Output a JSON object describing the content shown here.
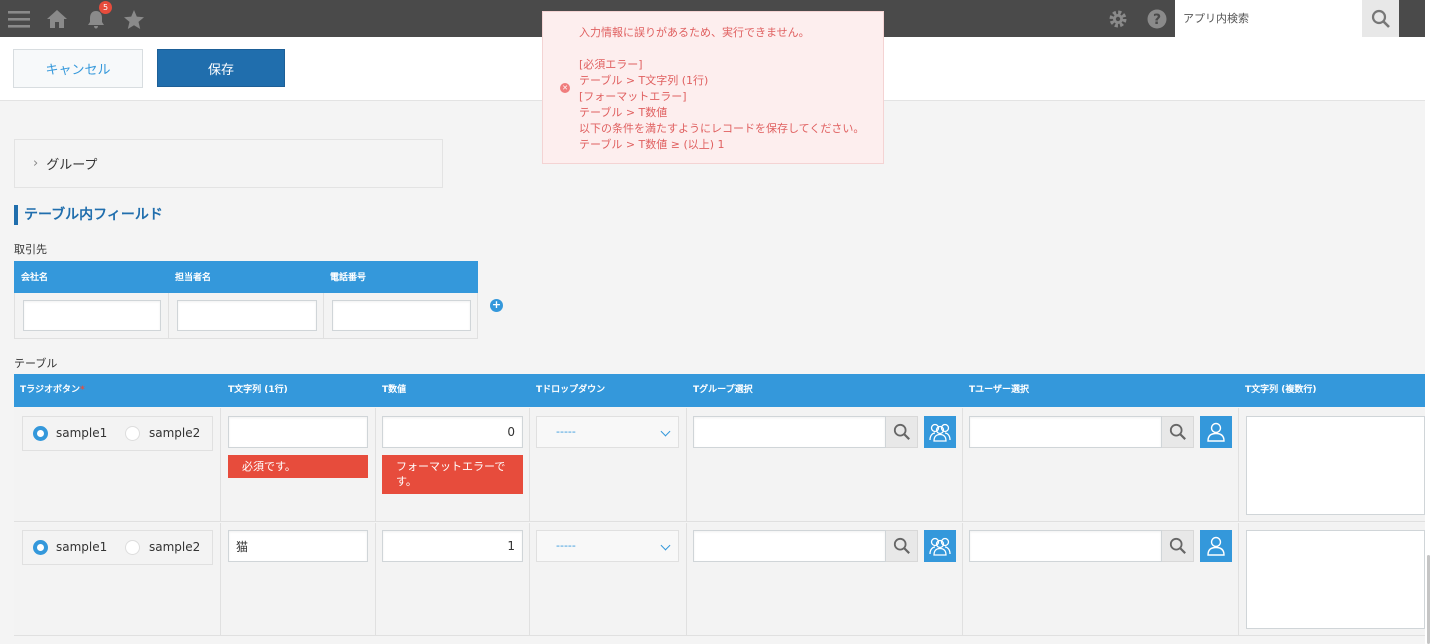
{
  "topbar": {
    "notification_count": "5",
    "search_placeholder": "アプリ内検索"
  },
  "actions": {
    "cancel_label": "キャンセル",
    "save_label": "保存"
  },
  "group": {
    "label": "グループ"
  },
  "section": {
    "title": "テーブル内フィールド"
  },
  "table1": {
    "label": "取引先",
    "headers": [
      "会社名",
      "担当者名",
      "電話番号"
    ]
  },
  "table2": {
    "label": "テーブル",
    "headers": [
      "Tラジオボタン",
      "T文字列 (1行)",
      "T数値",
      "Tドロップダウン",
      "Tグループ選択",
      "Tユーザー選択",
      "T文字列 (複数行)"
    ],
    "required_mark": "*",
    "rows": [
      {
        "radio_options": [
          "sample1",
          "sample2"
        ],
        "selected": "sample1",
        "text_value": "",
        "number_value": "0",
        "dropdown_value": "-----",
        "text_error": "必須です。",
        "number_error_line1": "フォーマットエラーで",
        "number_error_line2": "す。"
      },
      {
        "radio_options": [
          "sample1",
          "sample2"
        ],
        "selected": "sample1",
        "text_value": "猫",
        "number_value": "1",
        "dropdown_value": "-----"
      }
    ]
  },
  "error_popup": {
    "lines": [
      "入力情報に誤りがあるため、実行できません。",
      "",
      "[必須エラー]",
      "テーブル > T文字列 (1行)",
      "[フォーマットエラー]",
      "テーブル > T数値",
      "以下の条件を満たすようにレコードを保存してください。",
      "テーブル > T数値 ≥ (以上) 1"
    ]
  },
  "colors": {
    "topbar": "#4a4a4a",
    "accent": "#3498db",
    "save": "#206ead",
    "error": "#e74c3c",
    "popup_bg": "#fdeeee"
  }
}
